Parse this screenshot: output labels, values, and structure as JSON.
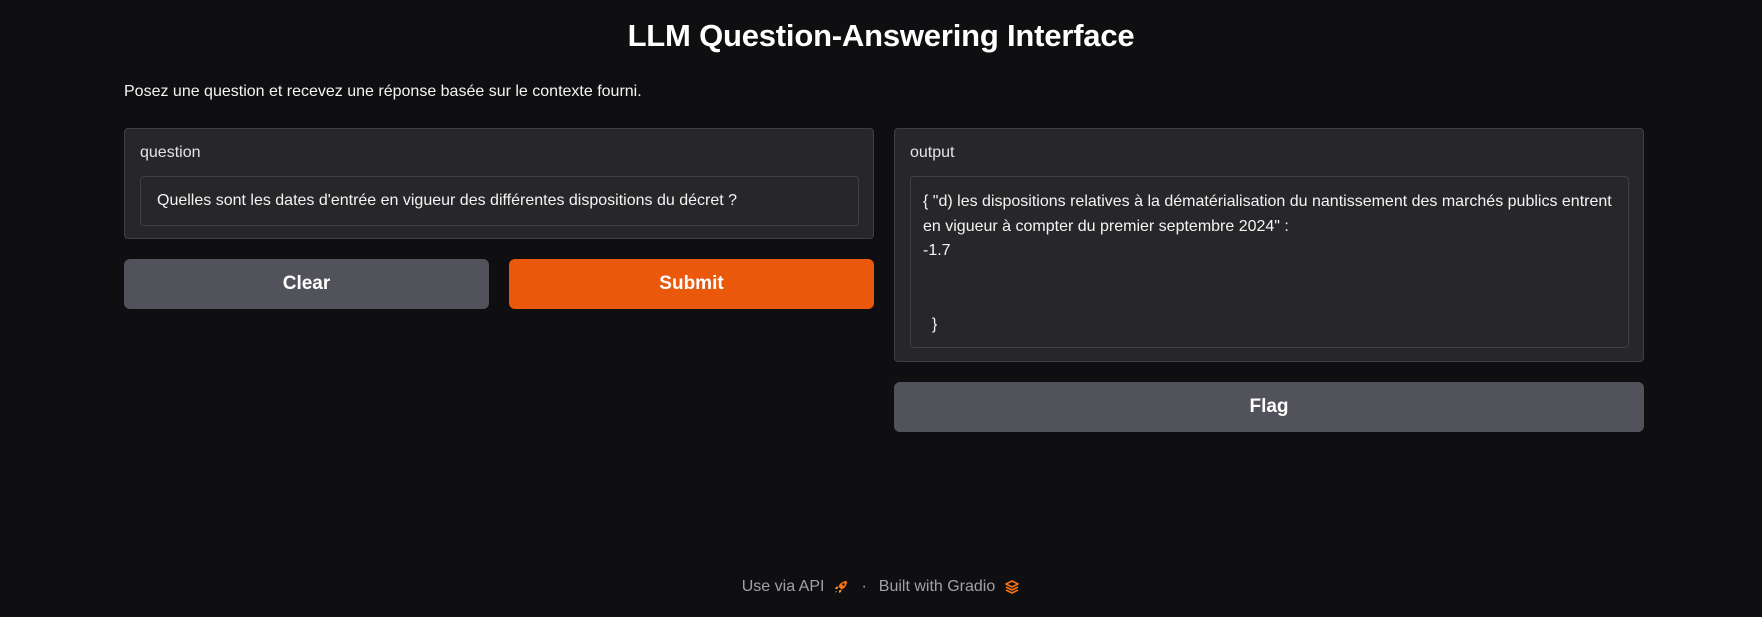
{
  "header": {
    "title": "LLM Question-Answering Interface",
    "description": "Posez une question et recevez une réponse basée sur le contexte fourni."
  },
  "input_panel": {
    "label": "question",
    "value": "Quelles sont les dates d'entrée en vigueur des différentes dispositions du décret ?"
  },
  "output_panel": {
    "label": "output",
    "value": "{ \"d) les dispositions relatives à la dématérialisation du nantissement des marchés publics entrent en vigueur à compter du premier septembre 2024\" :\n-1.7\n\n\n  }"
  },
  "buttons": {
    "clear": "Clear",
    "submit": "Submit",
    "flag": "Flag"
  },
  "footer": {
    "api_link": "Use via API",
    "separator": "·",
    "built_with": "Built with Gradio",
    "api_icon": "rocket-icon",
    "gradio_icon": "gradio-logo-icon"
  },
  "colors": {
    "background": "#0f0f11",
    "panel": "#27272a",
    "primary": "#ea580c",
    "secondary": "#52525b"
  }
}
